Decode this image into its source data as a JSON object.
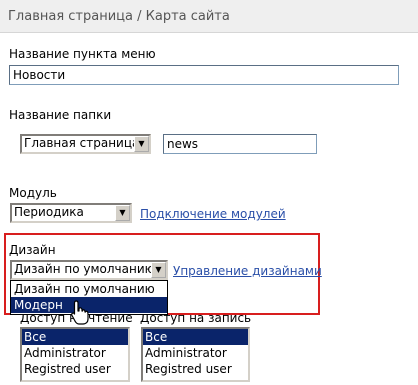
{
  "breadcrumb": "Главная страница / Карта сайта",
  "menu_item": {
    "label": "Название пункта меню",
    "value": "Новости"
  },
  "folder": {
    "label": "Название папки",
    "parent": "Главная страница",
    "name": "news"
  },
  "module": {
    "label": "Модуль",
    "value": "Периодика",
    "link": "Подключение модулей"
  },
  "design": {
    "label": "Дизайн",
    "value": "Дизайн по умолчанию",
    "link": "Управление дизайнами",
    "options": [
      "Дизайн по умолчанию",
      "Модерн"
    ],
    "highlight_color": "#d81e1e"
  },
  "read_access": {
    "label": "Доступ на чтение",
    "items": [
      "Все",
      "Administrator",
      "Registred user"
    ]
  },
  "write_access": {
    "label": "Доступ на запись",
    "items": [
      "Все",
      "Administrator",
      "Registred user"
    ]
  },
  "icons": {
    "dropdown": "chevron-down-icon",
    "cursor": "hand-pointer-icon"
  },
  "colors": {
    "link": "#2a4fa8",
    "selection": "#0a246a"
  }
}
